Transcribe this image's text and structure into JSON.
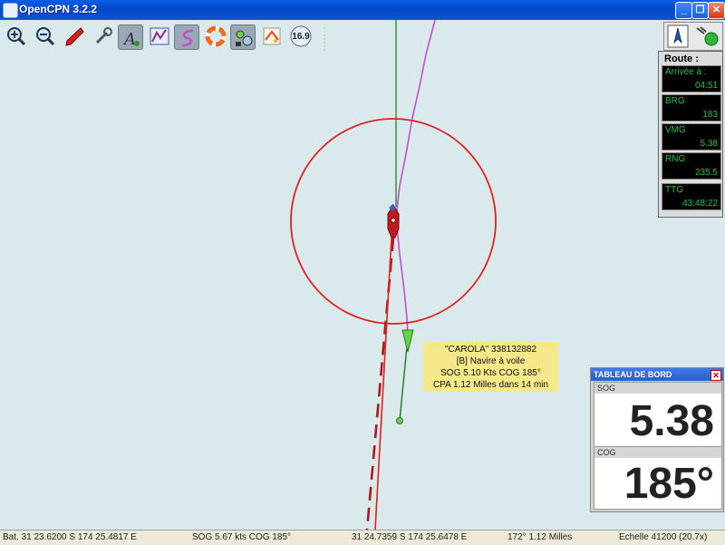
{
  "window": {
    "title": "OpenCPN 3.2.2",
    "minimize": "_",
    "maximize": "❐",
    "close": "✕"
  },
  "toolbar": {
    "items": [
      {
        "name": "zoom-in",
        "icon": "zoom-in-icon"
      },
      {
        "name": "zoom-out",
        "icon": "zoom-out-icon"
      },
      {
        "name": "center-on-ship",
        "icon": "ship-icon"
      },
      {
        "name": "settings",
        "icon": "wrench-icon"
      },
      {
        "name": "text-toggle",
        "icon": "text-icon",
        "pressed": true
      },
      {
        "name": "route-manager",
        "icon": "route-icon"
      },
      {
        "name": "track",
        "icon": "track-icon",
        "pressed": true
      },
      {
        "name": "mob",
        "icon": "lifebuoy-icon"
      },
      {
        "name": "ais",
        "icon": "ais-icon",
        "pressed": true
      },
      {
        "name": "current-tide",
        "icon": "tide-icon"
      },
      {
        "name": "chart-scale",
        "icon": "scale-badge-icon",
        "label": "16.9"
      }
    ]
  },
  "route_panel": {
    "title": "Route :",
    "fields": [
      {
        "label": "Arrivée à :",
        "value": "04:51"
      },
      {
        "label": "BRG",
        "value": "183"
      },
      {
        "label": "VMG",
        "value": "5.38"
      },
      {
        "label": "RNG",
        "value": "235.5"
      },
      {
        "label": "TTG",
        "value": "43:48:22"
      }
    ]
  },
  "ais_tooltip": {
    "line1": "\"CAROLA\" 338132882",
    "line2": "[B] Navire à voile",
    "line3": "SOG 5.10 Kts   COG 185°",
    "line4": "CPA 1.12 Milles dans 14 min"
  },
  "dashboard": {
    "title": "TABLEAU DE BORD",
    "close": "✕",
    "instruments": [
      {
        "caption": "SOG",
        "value": "5.38"
      },
      {
        "caption": "COG",
        "value": "185°"
      }
    ]
  },
  "status_bar": {
    "position": "Bat. 31 23.6200 S    174 25.4817 E",
    "sog_cog": "SOG 5.67 kts  COG 185°",
    "cursor": "31 24.7359 S    174 25.6478 E",
    "bearing_dist": "172°  1.12 Milles",
    "scale": "Echelle 41200 (20.7x)"
  },
  "colors": {
    "sea": "#d9e9ec",
    "own_ship": "#c21a1a",
    "range_ring": "#e02020",
    "course_line": "#c21a1a",
    "route_line": "#1a7a1a",
    "track_line": "#c04fd0",
    "ais_target": "#6bd04a",
    "instrument_green": "#29c043"
  }
}
